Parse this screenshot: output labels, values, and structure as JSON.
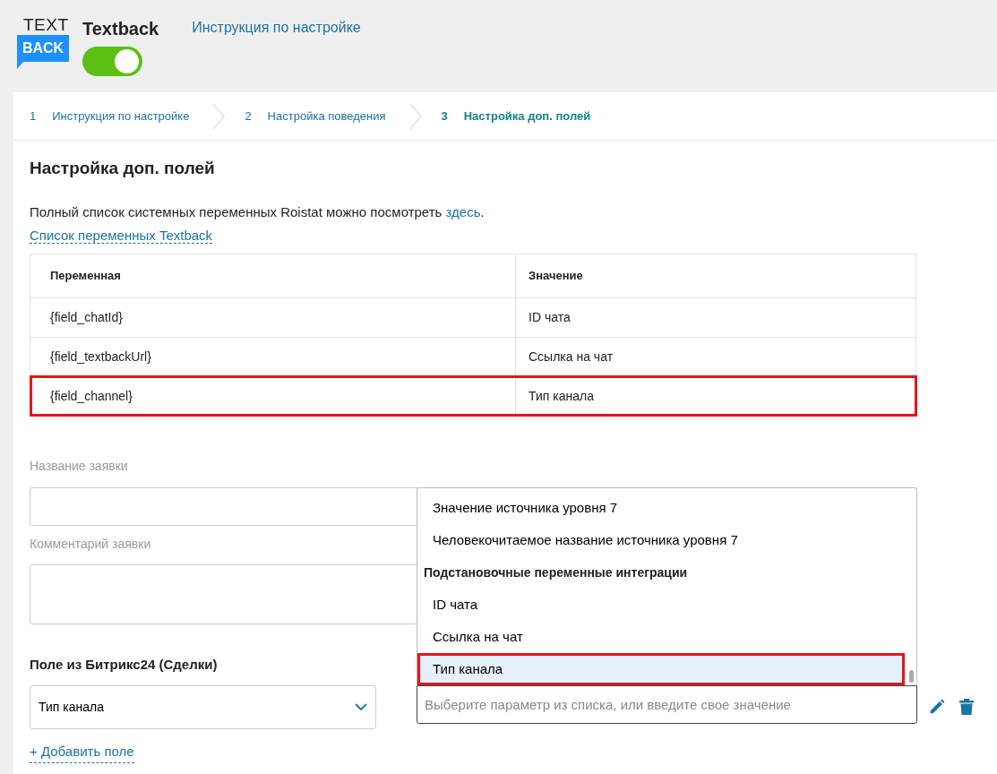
{
  "header": {
    "logo": {
      "top": "TEXT",
      "bottom": "BACK"
    },
    "title": "Textback",
    "enabled": true,
    "help_link": "Инструкция по настройке"
  },
  "steps": [
    {
      "number": "1",
      "label": "Инструкция по настройке",
      "selected": false
    },
    {
      "number": "2",
      "label": "Настройка поведения",
      "selected": false
    },
    {
      "number": "3",
      "label": "Настройка доп. полей",
      "selected": true
    }
  ],
  "section": {
    "title": "Настройка доп. полей",
    "intro": "Полный список системных переменных Roistat можно посмотреть ",
    "intro_link": "здесь",
    "intro_end": ".",
    "variables_link": "Список переменных Textback"
  },
  "table": {
    "columns": [
      "Переменная",
      "Значение"
    ],
    "rows": [
      {
        "cells": [
          "{field_chatId}",
          "ID чата"
        ],
        "highlighted": false
      },
      {
        "cells": [
          "{field_textbackUrl}",
          "Ссылка на чат"
        ],
        "highlighted": false
      },
      {
        "cells": [
          "{field_channel}",
          "Тип канала"
        ],
        "highlighted": true
      }
    ]
  },
  "fields": [
    {
      "label": "Название заявки",
      "kind": "input"
    },
    {
      "label": "Комментарий заявки",
      "kind": "textarea"
    }
  ],
  "mapping": {
    "label": "Поле из Битрикс24 (Сделки)",
    "select_value": "Тип канала",
    "value_placeholder": "Выберите параметр из списка, или введите свое значение",
    "dropdown": [
      {
        "kind": "option",
        "label": "Значение источника уровня 7",
        "selected": false,
        "highlighted": false
      },
      {
        "kind": "option",
        "label": "Человекочитаемое название источника уровня 7",
        "selected": false,
        "highlighted": false
      },
      {
        "kind": "group",
        "label": "Подстановочные переменные интеграции"
      },
      {
        "kind": "option",
        "label": "ID чата",
        "selected": false,
        "highlighted": false
      },
      {
        "kind": "option",
        "label": "Ссылка на чат",
        "selected": false,
        "highlighted": false
      },
      {
        "kind": "option",
        "label": "Тип канала",
        "selected": true,
        "highlighted": true
      }
    ]
  },
  "add_field": "+ Добавить поле"
}
